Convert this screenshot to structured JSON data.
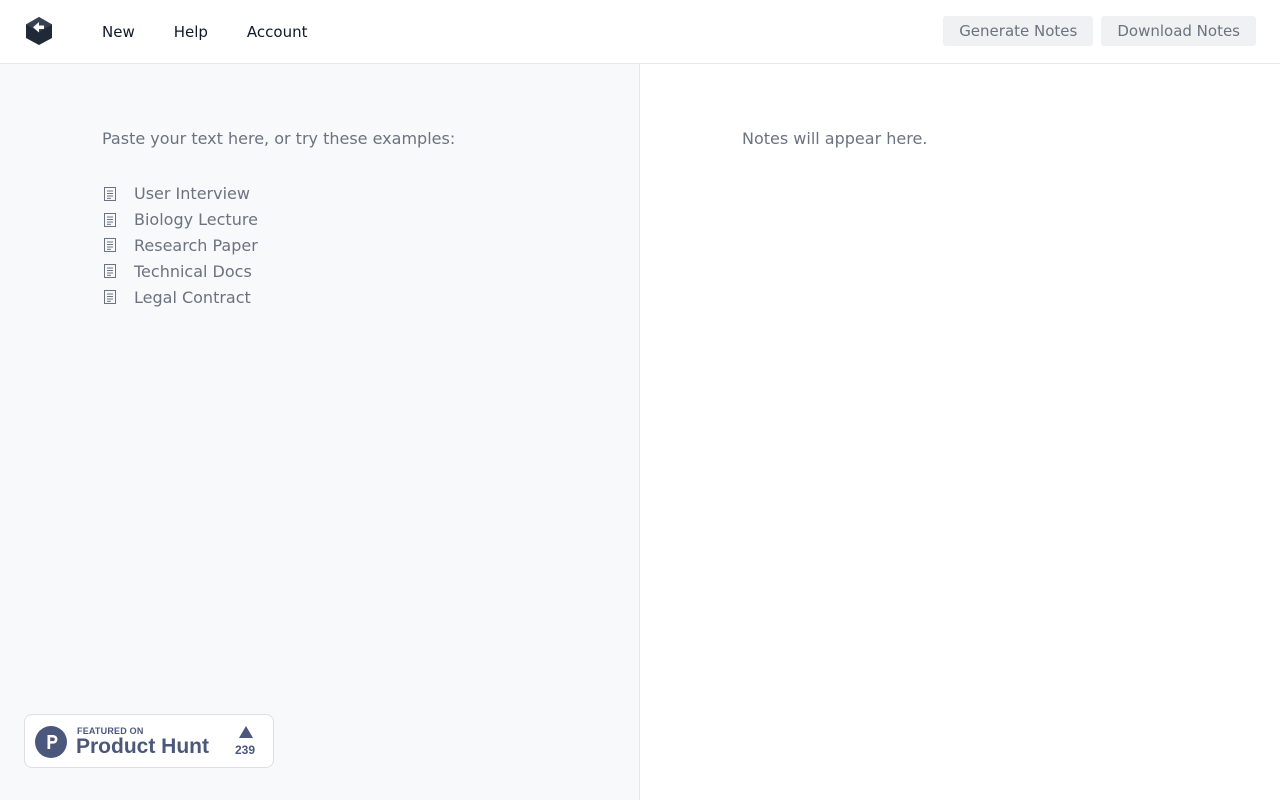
{
  "nav": {
    "items": [
      {
        "label": "New"
      },
      {
        "label": "Help"
      },
      {
        "label": "Account"
      }
    ]
  },
  "toolbar": {
    "generate_label": "Generate Notes",
    "download_label": "Download Notes"
  },
  "input_panel": {
    "prompt": "Paste your text here, or try these examples:",
    "examples": [
      {
        "label": "User Interview",
        "icon": "document-icon"
      },
      {
        "label": "Biology Lecture",
        "icon": "document-icon"
      },
      {
        "label": "Research Paper",
        "icon": "document-icon"
      },
      {
        "label": "Technical Docs",
        "icon": "document-icon"
      },
      {
        "label": "Legal Contract",
        "icon": "document-icon"
      }
    ]
  },
  "notes_panel": {
    "placeholder": "Notes will appear here."
  },
  "product_hunt_badge": {
    "featured_text": "FEATURED ON",
    "name": "Product Hunt",
    "upvotes": "239",
    "color": "#4b587c"
  },
  "colors": {
    "logo": "#1f2937",
    "muted_text": "#6b7280",
    "left_panel_bg": "#f8f9fb",
    "button_bg": "#f0f1f3"
  }
}
